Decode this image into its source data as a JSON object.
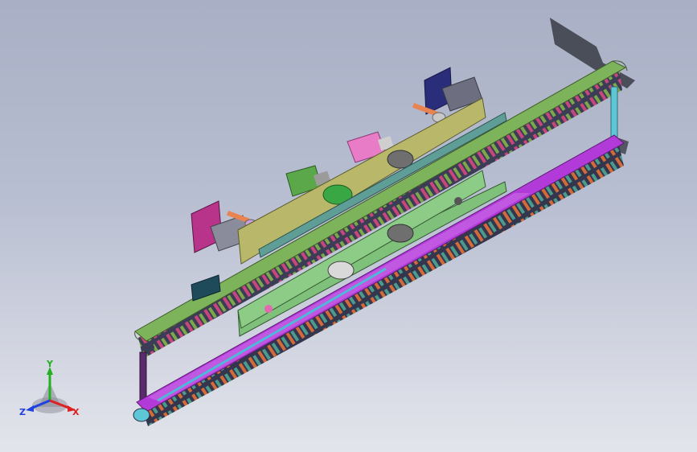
{
  "viewport": {
    "background_top": "#a9afc4",
    "background_bottom": "#e3e5ec"
  },
  "model": {
    "description_icon": "cad-assembly-chain-conveyor",
    "colors": {
      "upper_chain_plate": "#7db35a",
      "lower_chain_plate": "#b23ad8",
      "mid_plate_upper": "#b9b86a",
      "mid_plate_lower": "#7fc07a",
      "teal_plate": "#5e9e96",
      "motor_magenta": "#b8338a",
      "motor_navy": "#2a2d7a",
      "motor_pink": "#e87cc7",
      "motor_green": "#5aa84a",
      "cyan_post": "#5ec7d6",
      "purple_post": "#5b2a6e"
    }
  },
  "triad": {
    "x_label": "X",
    "y_label": "Y",
    "z_label": "Z",
    "x_color": "#e02020",
    "y_color": "#20b020",
    "z_color": "#2040e0"
  }
}
